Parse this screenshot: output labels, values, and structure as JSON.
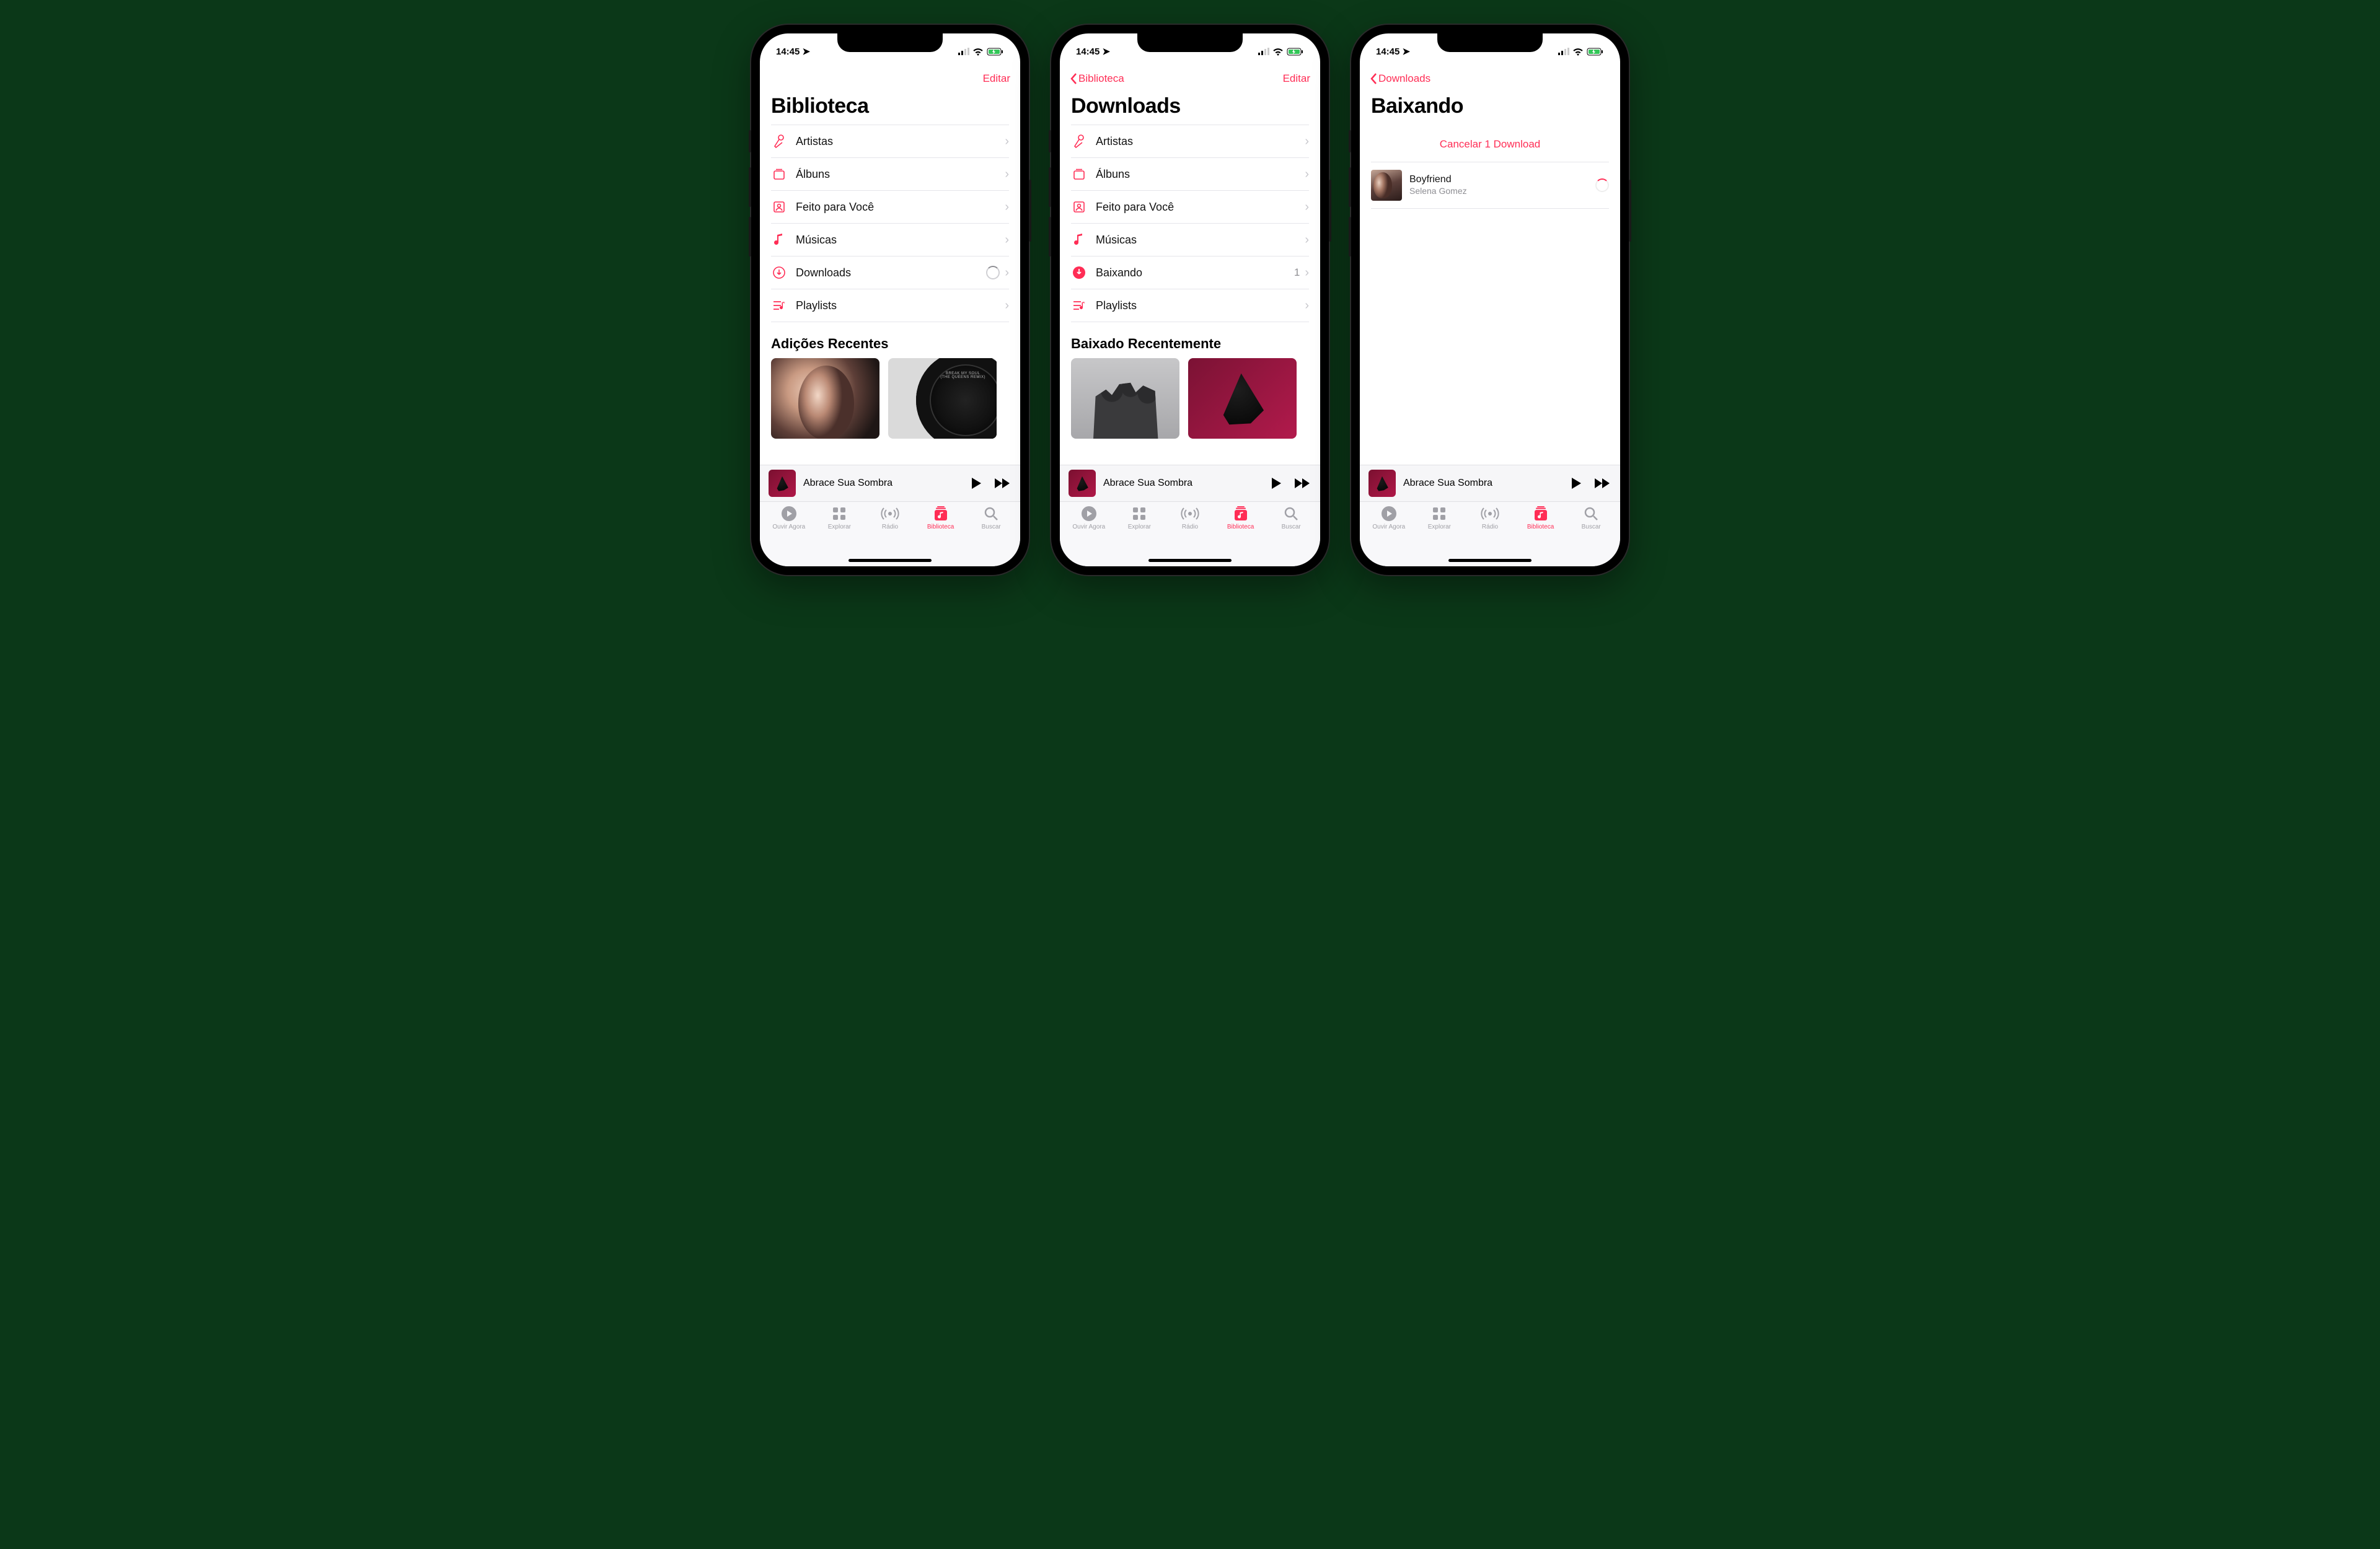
{
  "status": {
    "time": "14:45"
  },
  "tabbar": {
    "items": [
      {
        "label": "Ouvir Agora"
      },
      {
        "label": "Explorar"
      },
      {
        "label": "Rádio"
      },
      {
        "label": "Biblioteca"
      },
      {
        "label": "Buscar"
      }
    ]
  },
  "miniplayer": {
    "title": "Abrace Sua Sombra"
  },
  "screens": [
    {
      "nav": {
        "back": null,
        "edit": "Editar"
      },
      "title": "Biblioteca",
      "rows": [
        {
          "label": "Artistas"
        },
        {
          "label": "Álbuns"
        },
        {
          "label": "Feito para Você"
        },
        {
          "label": "Músicas"
        },
        {
          "label": "Downloads"
        },
        {
          "label": "Playlists"
        }
      ],
      "section": "Adições Recentes",
      "disc_label": "BREAK MY SOUL\n(THE QUEENS REMIX)"
    },
    {
      "nav": {
        "back": "Biblioteca",
        "edit": "Editar"
      },
      "title": "Downloads",
      "rows": [
        {
          "label": "Artistas"
        },
        {
          "label": "Álbuns"
        },
        {
          "label": "Feito para Você"
        },
        {
          "label": "Músicas"
        },
        {
          "label": "Baixando",
          "badge": "1"
        },
        {
          "label": "Playlists"
        }
      ],
      "section": "Baixado Recentemente"
    },
    {
      "nav": {
        "back": "Downloads",
        "edit": null
      },
      "title": "Baixando",
      "cancel": "Cancelar 1 Download",
      "download": {
        "title": "Boyfriend",
        "artist": "Selena Gomez"
      }
    }
  ]
}
